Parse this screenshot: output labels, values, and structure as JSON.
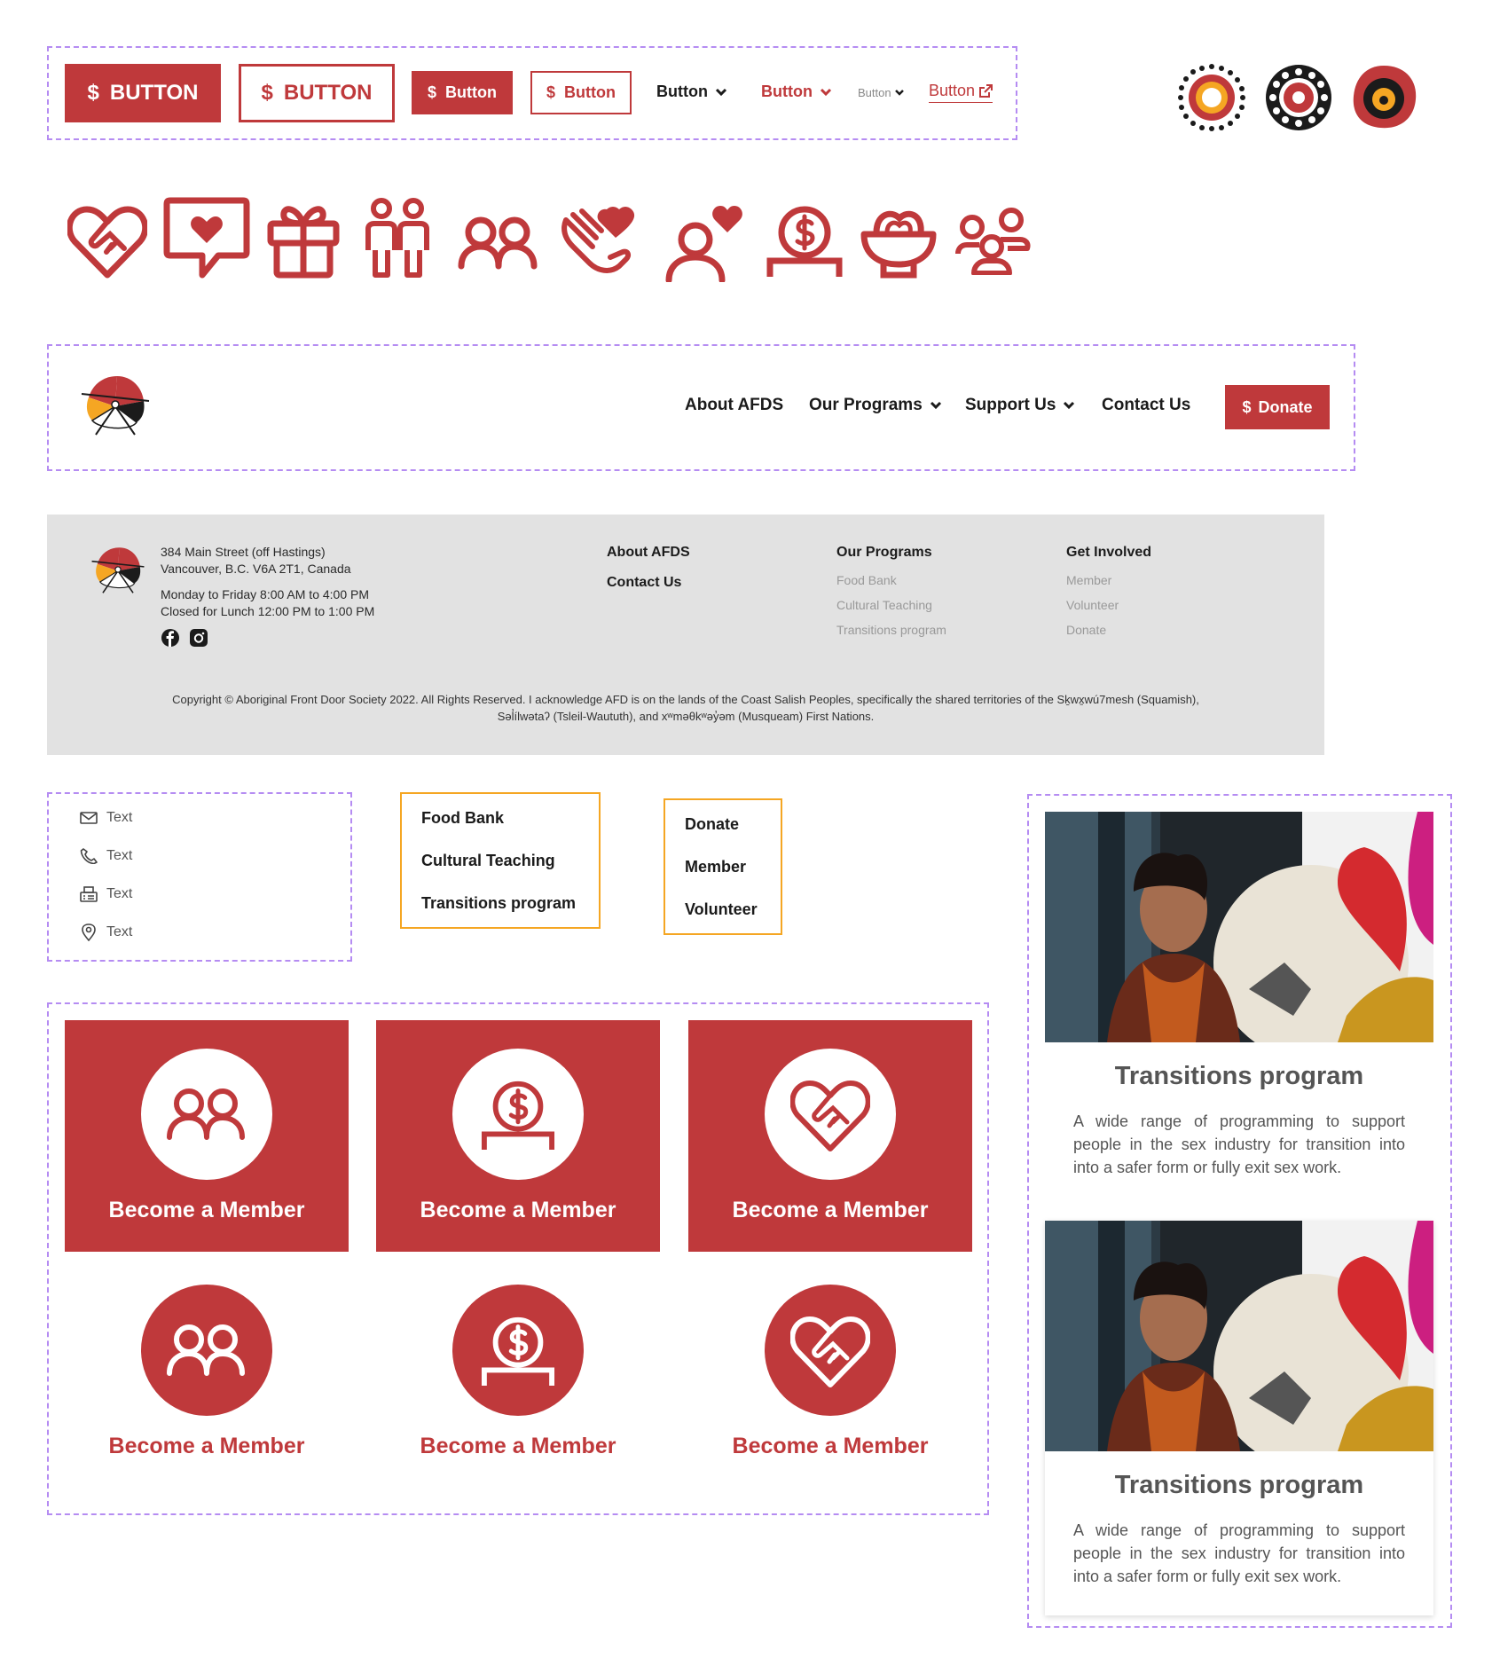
{
  "colors": {
    "brand_red": "#bf393b",
    "dash": "#b58cf2",
    "menu_border": "#f5a623",
    "footer_bg": "#e2e2e2"
  },
  "buttons": {
    "large_solid": "BUTTON",
    "large_outline": "BUTTON",
    "medium_solid": "Button",
    "medium_outline": "Button",
    "text_dark": "Button",
    "text_red": "Button",
    "text_small": "Button",
    "link_external": "Button",
    "dollar": "$"
  },
  "icons": [
    "handshake-heart-icon",
    "chat-heart-icon",
    "gift-icon",
    "people-pair-icon",
    "group-icon",
    "helping-hand-icon",
    "user-heart-icon",
    "donation-coin-icon",
    "food-bowl-icon",
    "community-icon"
  ],
  "nav": {
    "items": [
      "About AFDS",
      "Our Programs",
      "Support Us",
      "Contact Us"
    ],
    "donate": "Donate"
  },
  "footer": {
    "address_line1": "384 Main Street (off Hastings)",
    "address_line2": "Vancouver, B.C. V6A 2T1, Canada",
    "hours_line1": "Monday to Friday 8:00 AM to 4:00 PM",
    "hours_line2": "Closed for Lunch 12:00 PM to 1:00 PM",
    "col1": [
      "About AFDS",
      "Contact Us"
    ],
    "col2_heading": "Our Programs",
    "col2": [
      "Food Bank",
      "Cultural Teaching",
      "Transitions program"
    ],
    "col3_heading": "Get Involved",
    "col3": [
      "Member",
      "Volunteer",
      "Donate"
    ],
    "copyright_line1": "Copyright © Aboriginal Front Door Society 2022. All Rights Reserved. I acknowledge AFD is on the lands of the Coast Salish Peoples, specifically the shared territories of the Sḵwx̱wú7mesh (Squamish),",
    "copyright_line2": "Səl̓ílwətaʔ (Tsleil-Waututh), and xʷməθkʷəy̓əm (Musqueam) First Nations."
  },
  "contact_list": [
    "Text",
    "Text",
    "Text",
    "Text"
  ],
  "programs_menu": [
    "Food Bank",
    "Cultural Teaching",
    "Transitions program"
  ],
  "support_menu": [
    "Donate",
    "Member",
    "Volunteer"
  ],
  "cards": [
    "Become a Member",
    "Become a Member",
    "Become a Member",
    "Become a Member",
    "Become a Member",
    "Become a Member"
  ],
  "programs": [
    {
      "title": "Transitions program",
      "desc": "A wide range of programming to support people in the sex industry for transition into into a safer form or fully exit sex work."
    },
    {
      "title": "Transitions program",
      "desc": "A wide range of programming to support people in the sex industry for transition into into a safer form or fully exit sex work."
    }
  ]
}
